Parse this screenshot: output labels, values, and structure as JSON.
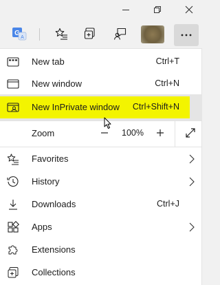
{
  "window": {
    "minimize_icon": "minimize-icon",
    "restore_icon": "restore-icon",
    "close_icon": "close-icon"
  },
  "toolbar": {
    "icons": [
      "translate-icon",
      "favorites-icon",
      "collections-icon",
      "feedback-icon",
      "profile-avatar",
      "more-icon"
    ]
  },
  "menu": {
    "items": [
      {
        "label": "New tab",
        "shortcut": "Ctrl+T",
        "icon": "new-tab-icon"
      },
      {
        "label": "New window",
        "shortcut": "Ctrl+N",
        "icon": "new-window-icon"
      },
      {
        "label": "New InPrivate window",
        "shortcut": "Ctrl+Shift+N",
        "icon": "inprivate-icon",
        "highlighted": true
      },
      {
        "label": "Favorites",
        "shortcut": "",
        "icon": "favorites-icon",
        "submenu": true
      },
      {
        "label": "History",
        "shortcut": "",
        "icon": "history-icon",
        "submenu": true
      },
      {
        "label": "Downloads",
        "shortcut": "Ctrl+J",
        "icon": "downloads-icon"
      },
      {
        "label": "Apps",
        "shortcut": "",
        "icon": "apps-icon",
        "submenu": true
      },
      {
        "label": "Extensions",
        "shortcut": "",
        "icon": "extensions-icon"
      },
      {
        "label": "Collections",
        "shortcut": "",
        "icon": "collections-icon"
      }
    ],
    "zoom": {
      "label": "Zoom",
      "minus": "−",
      "value": "100%",
      "plus": "+",
      "fullscreen_icon": "fullscreen-icon"
    }
  },
  "colors": {
    "highlight": "#f3f400",
    "background": "#f1f1f1",
    "menu_bg": "#ffffff",
    "text": "#1b1b1b"
  }
}
